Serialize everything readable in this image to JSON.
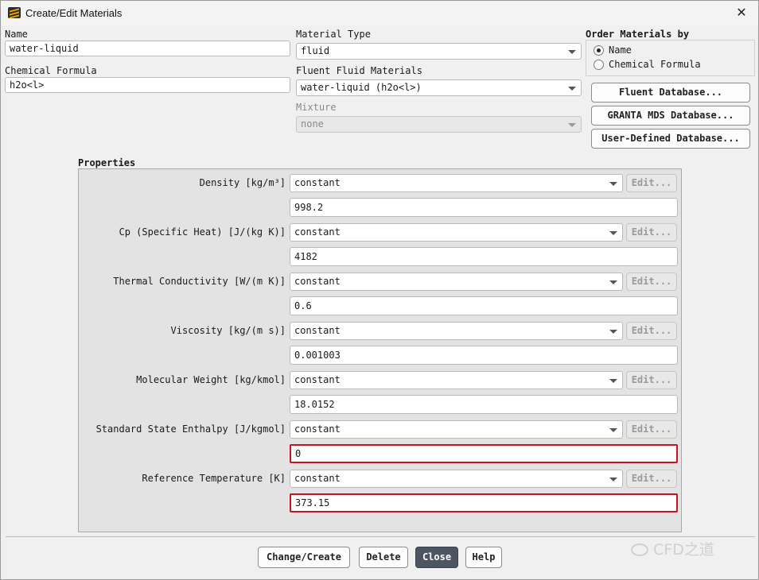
{
  "window": {
    "title": "Create/Edit Materials",
    "close_label": "✕"
  },
  "name": {
    "label": "Name",
    "value": "water-liquid"
  },
  "chemical_formula": {
    "label": "Chemical Formula",
    "value": "h2o<l>"
  },
  "material_type": {
    "label": "Material Type",
    "value": "fluid"
  },
  "fluent_fluid_materials": {
    "label": "Fluent Fluid Materials",
    "value": "water-liquid (h2o<l>)"
  },
  "mixture": {
    "label": "Mixture",
    "value": "none"
  },
  "order_by": {
    "label": "Order Materials by",
    "options": [
      {
        "label": "Name",
        "selected": true
      },
      {
        "label": "Chemical Formula",
        "selected": false
      }
    ]
  },
  "databases": {
    "fluent": "Fluent Database...",
    "granta": "GRANTA MDS Database...",
    "user_defined": "User-Defined Database..."
  },
  "properties": {
    "label": "Properties",
    "items": [
      {
        "label": "Density [kg/m³]",
        "method": "constant",
        "value": "998.2",
        "edit": "Edit...",
        "highlight": false
      },
      {
        "label": "Cp (Specific Heat) [J/(kg K)]",
        "method": "constant",
        "value": "4182",
        "edit": "Edit...",
        "highlight": false
      },
      {
        "label": "Thermal Conductivity [W/(m K)]",
        "method": "constant",
        "value": "0.6",
        "edit": "Edit...",
        "highlight": false
      },
      {
        "label": "Viscosity [kg/(m s)]",
        "method": "constant",
        "value": "0.001003",
        "edit": "Edit...",
        "highlight": false
      },
      {
        "label": "Molecular Weight [kg/kmol]",
        "method": "constant",
        "value": "18.0152",
        "edit": "Edit...",
        "highlight": false
      },
      {
        "label": "Standard State Enthalpy [J/kgmol]",
        "method": "constant",
        "value": "0",
        "edit": "Edit...",
        "highlight": true
      },
      {
        "label": "Reference Temperature [K]",
        "method": "constant",
        "value": "373.15",
        "edit": "Edit...",
        "highlight": true
      }
    ]
  },
  "buttons": {
    "change_create": "Change/Create",
    "delete": "Delete",
    "close": "Close",
    "help": "Help"
  },
  "watermark": {
    "text": "CFD之道"
  },
  "colors": {
    "highlight": "#c8141e",
    "primary_button": "#4d5560"
  }
}
